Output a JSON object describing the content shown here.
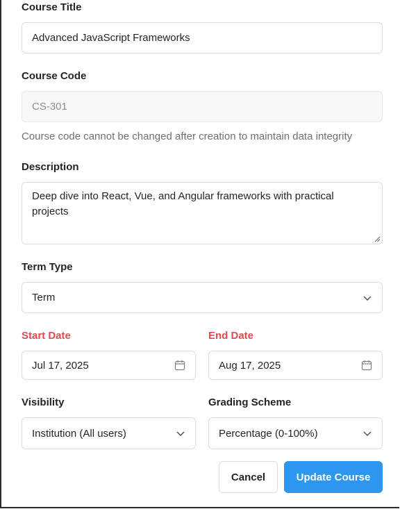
{
  "form": {
    "title_label": "Course Title",
    "title_value": "Advanced JavaScript Frameworks",
    "code_label": "Course Code",
    "code_value": "CS-301",
    "code_helper": "Course code cannot be changed after creation to maintain data integrity",
    "description_label": "Description",
    "description_value": "Deep dive into React, Vue, and Angular frameworks with practical projects",
    "term_type_label": "Term Type",
    "term_type_value": "Term",
    "start_date_label": "Start Date",
    "start_date_value": "Jul 17, 2025",
    "end_date_label": "End Date",
    "end_date_value": "Aug 17, 2025",
    "visibility_label": "Visibility",
    "visibility_value": "Institution (All users)",
    "grading_label": "Grading Scheme",
    "grading_value": "Percentage (0-100%)"
  },
  "actions": {
    "cancel_label": "Cancel",
    "update_label": "Update Course"
  },
  "icons": {
    "dropdown": "chevron-down-icon",
    "date": "calendar-icon",
    "resize": "resize-handle-icon"
  },
  "colors": {
    "required_label": "#e5484d",
    "primary": "#2d96f0",
    "border": "#d9dce0"
  }
}
